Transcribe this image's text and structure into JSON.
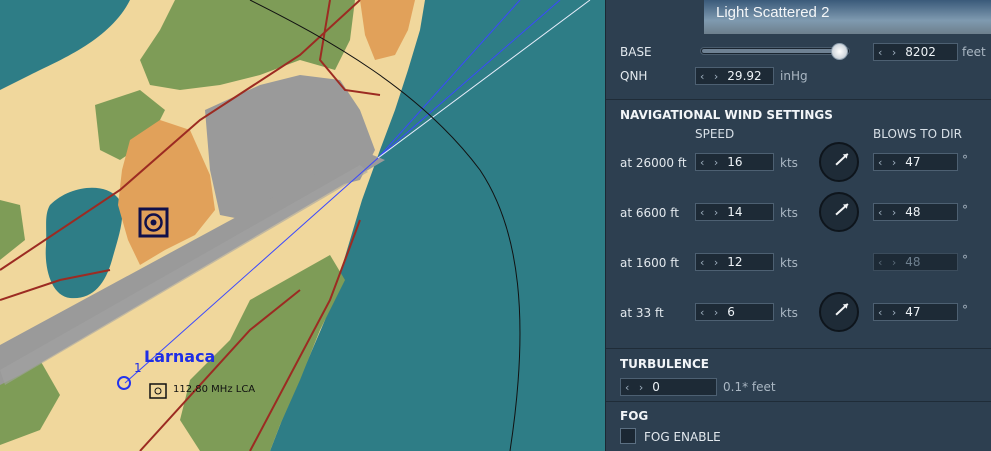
{
  "map": {
    "airport_name": "Larnaca",
    "runway_marker": "1",
    "navaid_label": "112.80 MHz LCA",
    "colors": {
      "sea": "#2e7d86",
      "sand": "#f0d79c",
      "vegetation": "#7e9c57",
      "urban": "#e1a15a",
      "runway": "#9a9a9a",
      "route": "#2233ee"
    }
  },
  "panel": {
    "cloud_preset": "Light Scattered 2",
    "base": {
      "label": "BASE",
      "value": "8202",
      "unit": "feet",
      "slider_fraction": 0.96
    },
    "qnh": {
      "label": "QNH",
      "value": "29.92",
      "unit": "inHg"
    },
    "wind": {
      "title": "NAVIGATIONAL WIND SETTINGS",
      "speed_header": "SPEED",
      "dir_header": "BLOWS TO DIR",
      "rows": [
        {
          "label": "at 26000 ft",
          "speed": "16",
          "speed_unit": "kts",
          "dir": "47",
          "dir_unit": "°",
          "dir_deg": 47
        },
        {
          "label": "at 6600 ft",
          "speed": "14",
          "speed_unit": "kts",
          "dir": "48",
          "dir_unit": "°",
          "dir_deg": 48
        },
        {
          "label": "at 1600 ft",
          "speed": "12",
          "speed_unit": "kts",
          "dir": "48",
          "dir_unit": "°",
          "dir_deg": 48
        },
        {
          "label": "at 33 ft",
          "speed": "6",
          "speed_unit": "kts",
          "dir": "47",
          "dir_unit": "°",
          "dir_deg": 47
        }
      ]
    },
    "turbulence": {
      "title": "TURBULENCE",
      "value": "0",
      "unit": "0.1* feet"
    },
    "fog": {
      "title": "FOG",
      "enable_label": "FOG ENABLE"
    },
    "arrows_glyph": "‹ ›"
  }
}
